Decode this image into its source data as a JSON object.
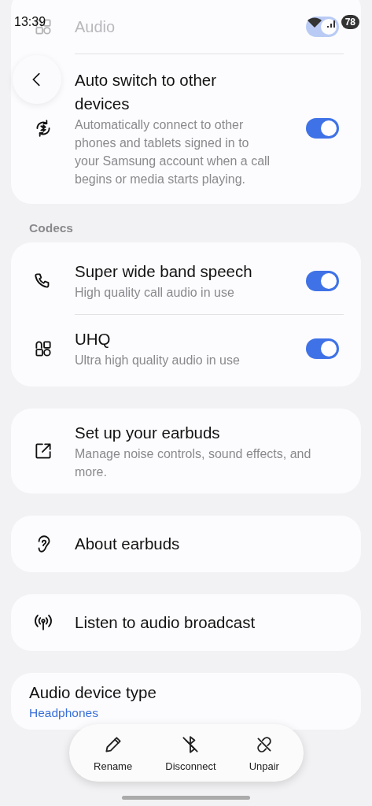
{
  "status_bar": {
    "time": "13:39",
    "battery": "78"
  },
  "faded_row": {
    "title": "Audio",
    "on": true
  },
  "groups": [
    {
      "rows": [
        {
          "kind": "toggle",
          "title": "Auto switch to other devices",
          "subtitle": "Automatically connect to other phones and tablets signed in to your Samsung account when a call begins or media starts playing.",
          "on": true
        }
      ]
    },
    {
      "heading": "Codecs",
      "rows": [
        {
          "kind": "toggle",
          "title": "Super wide band speech",
          "subtitle": "High quality call audio in use",
          "on": true
        },
        {
          "kind": "toggle",
          "title": "UHQ",
          "subtitle": "Ultra high quality audio in use",
          "on": true
        }
      ]
    },
    {
      "rows": [
        {
          "kind": "link",
          "title": "Set up your earbuds",
          "subtitle": "Manage noise controls, sound effects, and more."
        }
      ]
    },
    {
      "rows": [
        {
          "kind": "link",
          "title": "About earbuds"
        }
      ]
    },
    {
      "rows": [
        {
          "kind": "link",
          "title": "Listen to audio broadcast"
        }
      ]
    },
    {
      "rows": [
        {
          "kind": "value",
          "title": "Audio device type",
          "value": "Headphones"
        }
      ]
    }
  ],
  "actions": [
    {
      "label": "Rename"
    },
    {
      "label": "Disconnect"
    },
    {
      "label": "Unpair"
    }
  ]
}
